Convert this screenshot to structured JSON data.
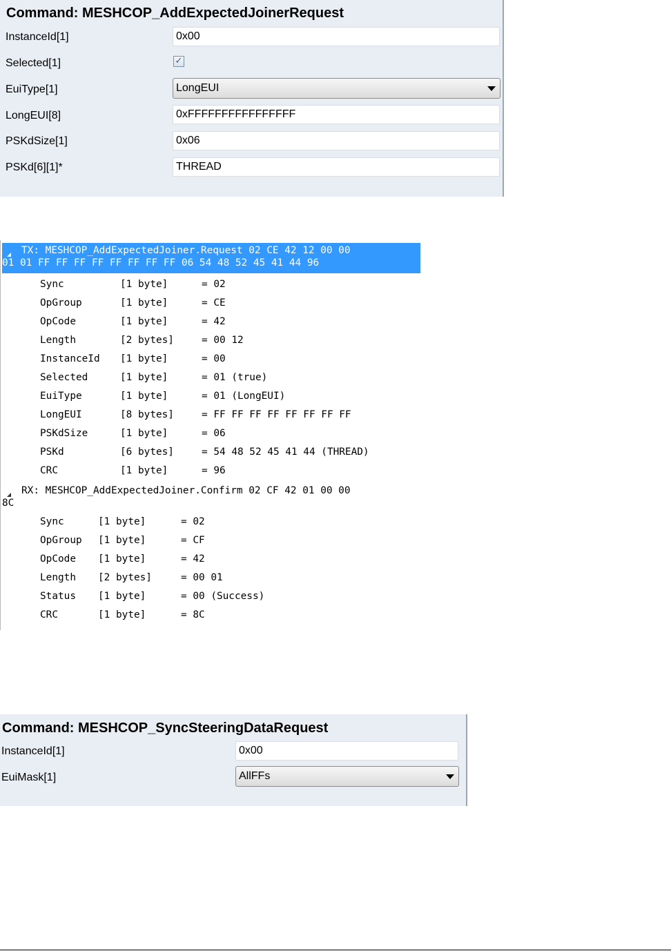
{
  "panel1": {
    "title": "Command: MESHCOP_AddExpectedJoinerRequest",
    "rows": [
      {
        "label": "InstanceId[1]",
        "value": "0x00"
      },
      {
        "label": "Selected[1]",
        "checked": "✓"
      },
      {
        "label": "EuiType[1]",
        "value": "LongEUI"
      },
      {
        "label": "LongEUI[8]",
        "value": "0xFFFFFFFFFFFFFFFF"
      },
      {
        "label": "PSKdSize[1]",
        "value": "0x06"
      },
      {
        "label": "PSKd[6][1]*",
        "value": "THREAD"
      }
    ]
  },
  "trace": {
    "tx": {
      "header_line1": "TX: MESHCOP_AddExpectedJoiner.Request 02 CE 42 12 00 00",
      "header_line2": "01 01 FF FF FF FF FF FF FF FF 06 54 48 52 45 41 44 96",
      "fields": [
        {
          "name": "Sync",
          "size": "[1 byte]",
          "value": "= 02"
        },
        {
          "name": "OpGroup",
          "size": "[1 byte]",
          "value": "= CE"
        },
        {
          "name": "OpCode",
          "size": "[1 byte]",
          "value": "= 42"
        },
        {
          "name": "Length",
          "size": "[2 bytes]",
          "value": "= 00 12"
        },
        {
          "name": "InstanceId",
          "size": "[1 byte]",
          "value": "= 00"
        },
        {
          "name": "Selected",
          "size": "[1 byte]",
          "value": "= 01 (true)"
        },
        {
          "name": "EuiType",
          "size": "[1 byte]",
          "value": "= 01 (LongEUI)"
        },
        {
          "name": "LongEUI",
          "size": "[8 bytes]",
          "value": "= FF FF FF FF FF FF FF FF"
        },
        {
          "name": "PSKdSize",
          "size": "[1 byte]",
          "value": "= 06"
        },
        {
          "name": "PSKd",
          "size": "[6 bytes]",
          "value": "= 54 48 52 45 41 44 (THREAD)"
        },
        {
          "name": "CRC",
          "size": "[1 byte]",
          "value": "= 96"
        }
      ]
    },
    "rx": {
      "header_line1": "RX: MESHCOP_AddExpectedJoiner.Confirm 02 CF 42 01 00 00",
      "header_line2": "8C",
      "fields": [
        {
          "name": "Sync",
          "size": "[1 byte]",
          "value": "= 02"
        },
        {
          "name": "OpGroup",
          "size": "[1 byte]",
          "value": "= CF"
        },
        {
          "name": "OpCode",
          "size": "[1 byte]",
          "value": "= 42"
        },
        {
          "name": "Length",
          "size": "[2 bytes]",
          "value": "= 00 01"
        },
        {
          "name": "Status",
          "size": "[1 byte]",
          "value": "= 00 (Success)"
        },
        {
          "name": "CRC",
          "size": "[1 byte]",
          "value": "= 8C"
        }
      ]
    }
  },
  "panel2": {
    "title": "Command: MESHCOP_SyncSteeringDataRequest",
    "rows": [
      {
        "label": "InstanceId[1]",
        "value": "0x00"
      },
      {
        "label": "EuiMask[1]",
        "value": "AllFFs"
      }
    ]
  }
}
